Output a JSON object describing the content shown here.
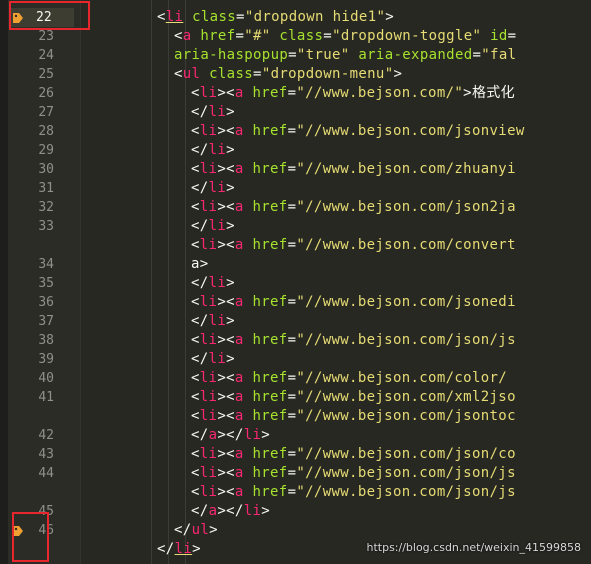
{
  "gutter": {
    "line_numbers": [
      "22",
      "23",
      "24",
      "25",
      "26",
      "27",
      "28",
      "29",
      "30",
      "31",
      "32",
      "33",
      "",
      "34",
      "35",
      "36",
      "37",
      "38",
      "39",
      "40",
      "41",
      "",
      "42",
      "43",
      "44",
      "",
      "45",
      "46"
    ],
    "active_line": "22",
    "bookmark_lines": [
      "22",
      "46"
    ]
  },
  "code_lines": [
    {
      "indent": 0,
      "tokens": [
        [
          "br",
          "<"
        ],
        [
          "tag",
          "li"
        ],
        [
          "txt",
          " "
        ],
        [
          "attr",
          "class"
        ],
        [
          "br",
          "="
        ],
        [
          "str",
          "\"dropdown hide1\""
        ],
        [
          "br",
          ">"
        ]
      ]
    },
    {
      "indent": 1,
      "tokens": [
        [
          "br",
          "<"
        ],
        [
          "tag",
          "a"
        ],
        [
          "txt",
          " "
        ],
        [
          "attr",
          "href"
        ],
        [
          "br",
          "="
        ],
        [
          "str",
          "\"#\""
        ],
        [
          "txt",
          " "
        ],
        [
          "attr",
          "class"
        ],
        [
          "br",
          "="
        ],
        [
          "str",
          "\"dropdown-toggle\""
        ],
        [
          "txt",
          " "
        ],
        [
          "attr",
          "id"
        ],
        [
          "br",
          "="
        ]
      ]
    },
    {
      "indent": 1,
      "tokens": [
        [
          "attr",
          "aria-haspopup"
        ],
        [
          "br",
          "="
        ],
        [
          "str",
          "\"true\""
        ],
        [
          "txt",
          " "
        ],
        [
          "attr",
          "aria-expanded"
        ],
        [
          "br",
          "="
        ],
        [
          "str",
          "\"fal"
        ]
      ]
    },
    {
      "indent": 1,
      "tokens": [
        [
          "br",
          "<"
        ],
        [
          "tag",
          "ul"
        ],
        [
          "txt",
          " "
        ],
        [
          "attr",
          "class"
        ],
        [
          "br",
          "="
        ],
        [
          "str",
          "\"dropdown-menu\""
        ],
        [
          "br",
          ">"
        ]
      ]
    },
    {
      "indent": 2,
      "tokens": [
        [
          "br",
          "<"
        ],
        [
          "tag",
          "li"
        ],
        [
          "br",
          "><"
        ],
        [
          "tag",
          "a"
        ],
        [
          "txt",
          " "
        ],
        [
          "attr",
          "href"
        ],
        [
          "br",
          "="
        ],
        [
          "str",
          "\"//www.bejson.com/\""
        ],
        [
          "br",
          ">"
        ],
        [
          "txt",
          "格式化"
        ]
      ]
    },
    {
      "indent": 2,
      "tokens": [
        [
          "br",
          "</"
        ],
        [
          "tag",
          "li"
        ],
        [
          "br",
          ">"
        ]
      ]
    },
    {
      "indent": 2,
      "tokens": [
        [
          "br",
          "<"
        ],
        [
          "tag",
          "li"
        ],
        [
          "br",
          "><"
        ],
        [
          "tag",
          "a"
        ],
        [
          "txt",
          " "
        ],
        [
          "attr",
          "href"
        ],
        [
          "br",
          "="
        ],
        [
          "str",
          "\"//www.bejson.com/jsonview"
        ]
      ]
    },
    {
      "indent": 2,
      "tokens": [
        [
          "br",
          "</"
        ],
        [
          "tag",
          "li"
        ],
        [
          "br",
          ">"
        ]
      ]
    },
    {
      "indent": 2,
      "tokens": [
        [
          "br",
          "<"
        ],
        [
          "tag",
          "li"
        ],
        [
          "br",
          "><"
        ],
        [
          "tag",
          "a"
        ],
        [
          "txt",
          " "
        ],
        [
          "attr",
          "href"
        ],
        [
          "br",
          "="
        ],
        [
          "str",
          "\"//www.bejson.com/zhuanyi"
        ]
      ]
    },
    {
      "indent": 2,
      "tokens": [
        [
          "br",
          "</"
        ],
        [
          "tag",
          "li"
        ],
        [
          "br",
          ">"
        ]
      ]
    },
    {
      "indent": 2,
      "tokens": [
        [
          "br",
          "<"
        ],
        [
          "tag",
          "li"
        ],
        [
          "br",
          "><"
        ],
        [
          "tag",
          "a"
        ],
        [
          "txt",
          " "
        ],
        [
          "attr",
          "href"
        ],
        [
          "br",
          "="
        ],
        [
          "str",
          "\"//www.bejson.com/json2ja"
        ]
      ]
    },
    {
      "indent": 2,
      "tokens": [
        [
          "br",
          "</"
        ],
        [
          "tag",
          "li"
        ],
        [
          "br",
          ">"
        ]
      ]
    },
    {
      "indent": 2,
      "tokens": [
        [
          "br",
          "<"
        ],
        [
          "tag",
          "li"
        ],
        [
          "br",
          "><"
        ],
        [
          "tag",
          "a"
        ],
        [
          "txt",
          " "
        ],
        [
          "attr",
          "href"
        ],
        [
          "br",
          "="
        ],
        [
          "str",
          "\"//www.bejson.com/convert"
        ]
      ]
    },
    {
      "indent": 2,
      "tokens": [
        [
          "txt",
          "a"
        ],
        [
          "br",
          ">"
        ]
      ]
    },
    {
      "indent": 2,
      "tokens": [
        [
          "br",
          "</"
        ],
        [
          "tag",
          "li"
        ],
        [
          "br",
          ">"
        ]
      ]
    },
    {
      "indent": 2,
      "tokens": [
        [
          "br",
          "<"
        ],
        [
          "tag",
          "li"
        ],
        [
          "br",
          "><"
        ],
        [
          "tag",
          "a"
        ],
        [
          "txt",
          " "
        ],
        [
          "attr",
          "href"
        ],
        [
          "br",
          "="
        ],
        [
          "str",
          "\"//www.bejson.com/jsonedi"
        ]
      ]
    },
    {
      "indent": 2,
      "tokens": [
        [
          "br",
          "</"
        ],
        [
          "tag",
          "li"
        ],
        [
          "br",
          ">"
        ]
      ]
    },
    {
      "indent": 2,
      "tokens": [
        [
          "br",
          "<"
        ],
        [
          "tag",
          "li"
        ],
        [
          "br",
          "><"
        ],
        [
          "tag",
          "a"
        ],
        [
          "txt",
          " "
        ],
        [
          "attr",
          "href"
        ],
        [
          "br",
          "="
        ],
        [
          "str",
          "\"//www.bejson.com/json/js"
        ]
      ]
    },
    {
      "indent": 2,
      "tokens": [
        [
          "br",
          "</"
        ],
        [
          "tag",
          "li"
        ],
        [
          "br",
          ">"
        ]
      ]
    },
    {
      "indent": 2,
      "tokens": [
        [
          "br",
          "<"
        ],
        [
          "tag",
          "li"
        ],
        [
          "br",
          "><"
        ],
        [
          "tag",
          "a"
        ],
        [
          "txt",
          " "
        ],
        [
          "attr",
          "href"
        ],
        [
          "br",
          "="
        ],
        [
          "str",
          "\"//www.bejson.com/color/"
        ]
      ]
    },
    {
      "indent": 2,
      "tokens": [
        [
          "br",
          "<"
        ],
        [
          "tag",
          "li"
        ],
        [
          "br",
          "><"
        ],
        [
          "tag",
          "a"
        ],
        [
          "txt",
          " "
        ],
        [
          "attr",
          "href"
        ],
        [
          "br",
          "="
        ],
        [
          "str",
          "\"//www.bejson.com/xml2jso"
        ]
      ]
    },
    {
      "indent": 2,
      "tokens": [
        [
          "br",
          "<"
        ],
        [
          "tag",
          "li"
        ],
        [
          "br",
          "><"
        ],
        [
          "tag",
          "a"
        ],
        [
          "txt",
          " "
        ],
        [
          "attr",
          "href"
        ],
        [
          "br",
          "="
        ],
        [
          "str",
          "\"//www.bejson.com/jsontoc"
        ]
      ]
    },
    {
      "indent": 2,
      "tokens": [
        [
          "br",
          "</"
        ],
        [
          "tag",
          "a"
        ],
        [
          "br",
          "></"
        ],
        [
          "tag",
          "li"
        ],
        [
          "br",
          ">"
        ]
      ]
    },
    {
      "indent": 2,
      "tokens": [
        [
          "br",
          "<"
        ],
        [
          "tag",
          "li"
        ],
        [
          "br",
          "><"
        ],
        [
          "tag",
          "a"
        ],
        [
          "txt",
          " "
        ],
        [
          "attr",
          "href"
        ],
        [
          "br",
          "="
        ],
        [
          "str",
          "\"//www.bejson.com/json/co"
        ]
      ]
    },
    {
      "indent": 2,
      "tokens": [
        [
          "br",
          "<"
        ],
        [
          "tag",
          "li"
        ],
        [
          "br",
          "><"
        ],
        [
          "tag",
          "a"
        ],
        [
          "txt",
          " "
        ],
        [
          "attr",
          "href"
        ],
        [
          "br",
          "="
        ],
        [
          "str",
          "\"//www.bejson.com/json/js"
        ]
      ]
    },
    {
      "indent": 2,
      "tokens": [
        [
          "br",
          "<"
        ],
        [
          "tag",
          "li"
        ],
        [
          "br",
          "><"
        ],
        [
          "tag",
          "a"
        ],
        [
          "txt",
          " "
        ],
        [
          "attr",
          "href"
        ],
        [
          "br",
          "="
        ],
        [
          "str",
          "\"//www.bejson.com/json/js"
        ]
      ]
    },
    {
      "indent": 2,
      "tokens": [
        [
          "br",
          "</"
        ],
        [
          "tag",
          "a"
        ],
        [
          "br",
          "></"
        ],
        [
          "tag",
          "li"
        ],
        [
          "br",
          ">"
        ]
      ]
    },
    {
      "indent": 1,
      "tokens": [
        [
          "br",
          "</"
        ],
        [
          "tag",
          "ul"
        ],
        [
          "br",
          ">"
        ]
      ]
    },
    {
      "indent": 0,
      "tokens": [
        [
          "br",
          "</"
        ],
        [
          "tag",
          "li"
        ],
        [
          "br",
          ">"
        ]
      ]
    }
  ],
  "watermark": "https://blog.csdn.net/weixin_41599858",
  "colors": {
    "background": "#272822",
    "tag": "#f92672",
    "attribute": "#a6e22e",
    "string": "#e6db74",
    "bracket": "#f8f8f2",
    "highlight_box": "#e8262d",
    "bookmark": "#f0a030"
  },
  "icons": {
    "bookmark": "tag-icon"
  }
}
